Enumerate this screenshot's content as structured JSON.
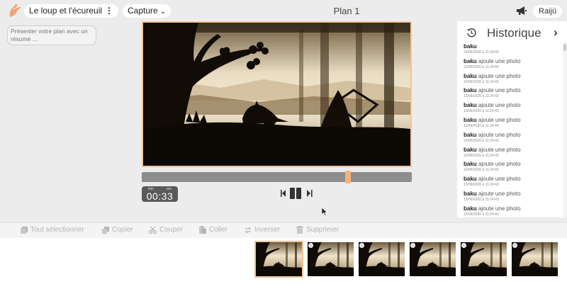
{
  "header": {
    "project_title": "Le loup et l'écureuil",
    "mode": "Capture",
    "plan_title": "Plan 1",
    "user": "Raijū"
  },
  "summary": {
    "placeholder": "Présenter votre plan avec un résumé ..."
  },
  "player": {
    "time_units": [
      "min",
      "sec"
    ],
    "time": "00:33",
    "progress_fraction": 0.77
  },
  "history": {
    "title": "Historique",
    "entries": [
      {
        "user": "baku",
        "action": "",
        "date": "13/06/2020 à 11:24:43"
      },
      {
        "user": "baku",
        "action": "ajoute une photo",
        "date": "13/06/2020 à 11:24:43"
      },
      {
        "user": "baku",
        "action": "ajoute une photo",
        "date": "13/06/2020 à 11:24:43"
      },
      {
        "user": "baku",
        "action": "ajoute une photo",
        "date": "13/06/2020 à 11:24:43"
      },
      {
        "user": "baku",
        "action": "ajoute une photo",
        "date": "13/06/2020 à 11:24:43"
      },
      {
        "user": "baku",
        "action": "ajoute une photo",
        "date": "13/06/2020 à 11:24:43"
      },
      {
        "user": "baku",
        "action": "ajoute une photo",
        "date": "13/06/2020 à 11:24:43"
      },
      {
        "user": "baku",
        "action": "ajoute une photo",
        "date": "13/06/2020 à 11:24:43"
      },
      {
        "user": "baku",
        "action": "ajoute une photo",
        "date": "13/06/2020 à 11:24:43"
      },
      {
        "user": "baku",
        "action": "ajoute une photo",
        "date": "13/06/2020 à 11:24:43"
      },
      {
        "user": "baku",
        "action": "ajoute une photo",
        "date": "13/06/2020 à 11:24:43"
      },
      {
        "user": "baku",
        "action": "ajoute une photo",
        "date": "13/06/2020 à 11:24:43"
      }
    ]
  },
  "toolbar": {
    "select_all": "Tout sélectionner",
    "copy": "Copier",
    "cut": "Couper",
    "paste": "Coller",
    "invert": "Inverser",
    "delete": "Supprimer"
  },
  "colors": {
    "accent": "#f2c597",
    "scrub_handle": "#f2b27a",
    "track": "#8d8d8d"
  }
}
